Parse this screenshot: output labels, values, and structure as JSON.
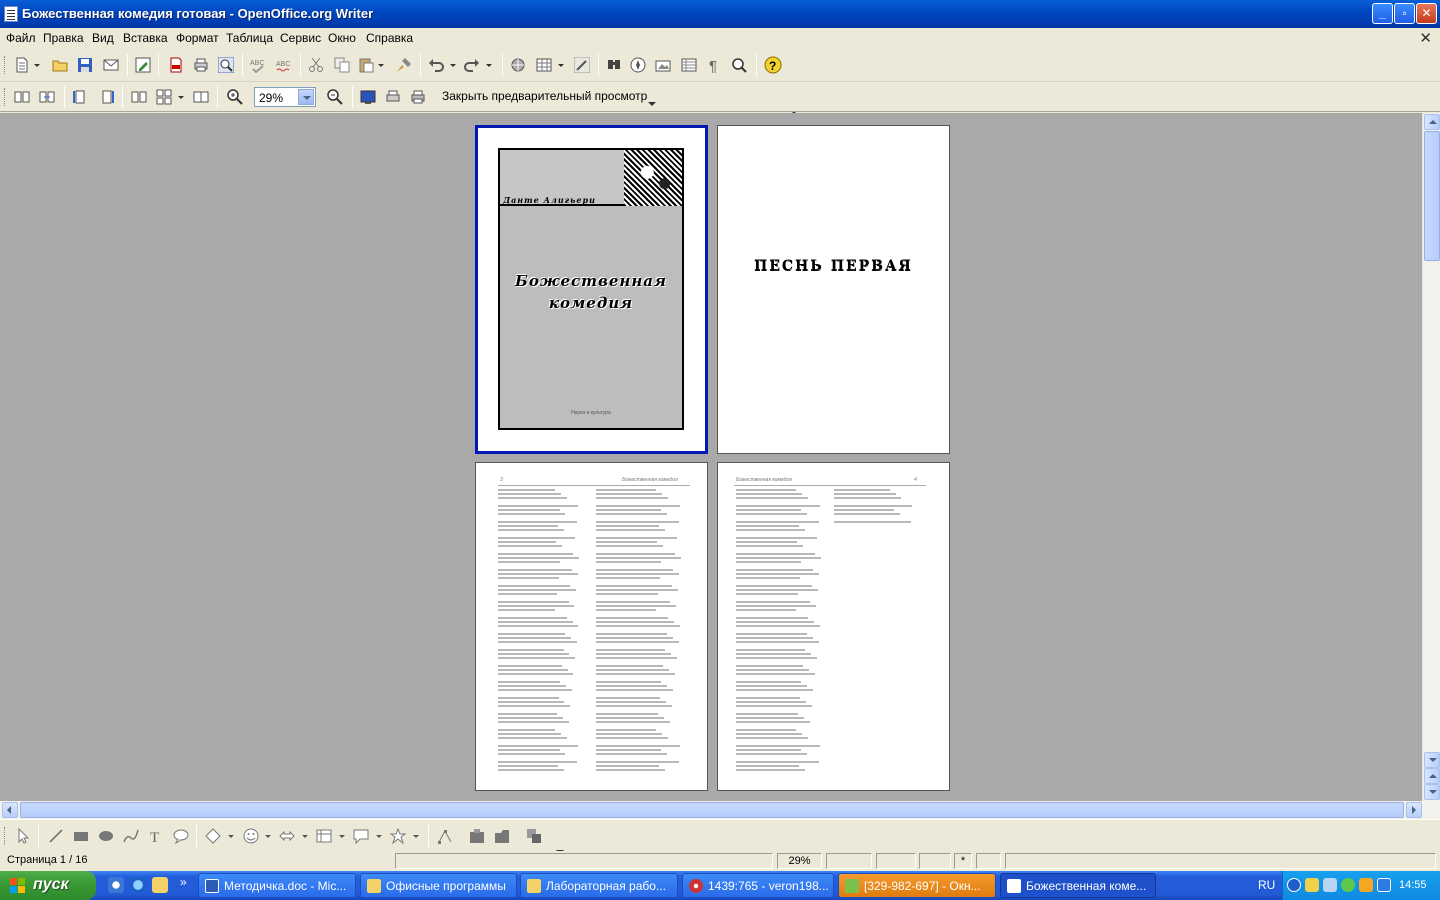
{
  "window": {
    "title": "Божественная комедия готовая - OpenOffice.org Writer",
    "minimize": "_",
    "restore": "▫",
    "close": "✕"
  },
  "menu": {
    "items": [
      "Файл",
      "Правка",
      "Вид",
      "Вставка",
      "Формат",
      "Таблица",
      "Сервис",
      "Окно",
      "Справка"
    ],
    "doc_close": "✕"
  },
  "preview_toolbar": {
    "zoom_value": "29%",
    "close_preview_label": "Закрыть предварительный просмотр"
  },
  "document": {
    "cover": {
      "author": "Данте Алигьери",
      "title_line1": "Божественная",
      "title_line2": "комедия",
      "publisher": "Наука и культура"
    },
    "page2": {
      "heading": "ПЕСНЬ ПЕРВАЯ"
    },
    "page3": {
      "header_num": "3",
      "header_title": "Божественная комедия"
    },
    "page4": {
      "header_title": "Божественная комедия",
      "header_num": "4"
    }
  },
  "statusbar": {
    "page": "Страница  1 / 16",
    "zoom": "29%",
    "insert_mode": "*"
  },
  "taskbar": {
    "start_label": "пуск",
    "tasks": [
      "Методичка.doc - Mic...",
      "Офисные программы",
      "Лабораторная рабо...",
      "1439:765 - veron198...",
      "[329-982-697] - Окн...",
      "Божественная коме..."
    ],
    "lang": "RU",
    "clock": "14:55"
  }
}
